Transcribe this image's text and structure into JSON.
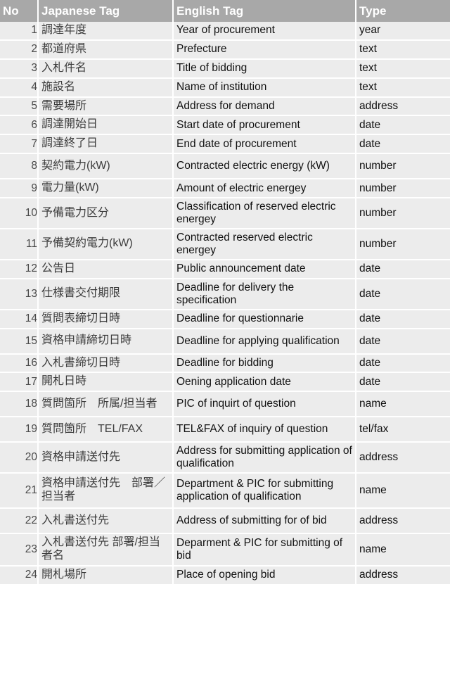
{
  "table": {
    "columns": [
      {
        "key": "no",
        "label": "No"
      },
      {
        "key": "ja",
        "label": "Japanese Tag"
      },
      {
        "key": "en",
        "label": "English Tag"
      },
      {
        "key": "type",
        "label": "Type"
      }
    ],
    "colors": {
      "header_background": "#a8a8a8",
      "header_text": "#ffffff",
      "row_background": "#ececec",
      "row_separator": "#ffffff",
      "body_text": "#111111",
      "japanese_text": "#3c3c3c",
      "page_background": "#ffffff"
    },
    "rows": [
      {
        "no": "1",
        "ja": "調達年度",
        "en": "Year of procurement",
        "type": "year",
        "lines": 1
      },
      {
        "no": "2",
        "ja": "都道府県",
        "en": "Prefecture",
        "type": "text",
        "lines": 1
      },
      {
        "no": "3",
        "ja": "入札件名",
        "en": "Title of bidding",
        "type": "text",
        "lines": 1
      },
      {
        "no": "4",
        "ja": "施設名",
        "en": "Name of institution",
        "type": "text",
        "lines": 1
      },
      {
        "no": "5",
        "ja": "需要場所",
        "en": "Address for demand",
        "type": "address",
        "lines": 1
      },
      {
        "no": "6",
        "ja": "調達開始日",
        "en": "Start date of procurement",
        "type": "date",
        "lines": 1
      },
      {
        "no": "7",
        "ja": "調達終了日",
        "en": "End date of procurement",
        "type": "date",
        "lines": 1
      },
      {
        "no": "8",
        "ja": "契約電力(kW)",
        "en": "Contracted electric energy (kW)",
        "type": "number",
        "lines": 2
      },
      {
        "no": "9",
        "ja": "電力量(kW)",
        "en": "Amount of electric energey",
        "type": "number",
        "lines": 1
      },
      {
        "no": "10",
        "ja": "予備電力区分",
        "en": "Classification of reserved electric energey",
        "type": "number",
        "lines": 2
      },
      {
        "no": "11",
        "ja": "予備契約電力(kW)",
        "en": "Contracted reserved electric energey",
        "type": "number",
        "lines": 2
      },
      {
        "no": "12",
        "ja": "公告日",
        "en": "Public announcement date",
        "type": "date",
        "lines": 1
      },
      {
        "no": "13",
        "ja": "仕様書交付期限",
        "en": "Deadline for delivery the specification",
        "type": "date",
        "lines": 2
      },
      {
        "no": "14",
        "ja": "質問表締切日時",
        "en": "Deadline for questionnarie",
        "type": "date",
        "lines": 1
      },
      {
        "no": "15",
        "ja": "資格申請締切日時",
        "en": "Deadline for applying qualification",
        "type": "date",
        "lines": 2
      },
      {
        "no": "16",
        "ja": "入札書締切日時",
        "en": "Deadline for bidding",
        "type": "date",
        "lines": 1
      },
      {
        "no": "17",
        "ja": "開札日時",
        "en": "Oening application date",
        "type": "date",
        "lines": 1
      },
      {
        "no": "18",
        "ja": "質問箇所　所属/担当者",
        "en": "PIC of inquirt of question",
        "type": "name",
        "lines": 2
      },
      {
        "no": "19",
        "ja": "質問箇所　TEL/FAX",
        "en": "TEL&FAX of inquiry of question",
        "type": "tel/fax",
        "lines": 2
      },
      {
        "no": "20",
        "ja": "資格申請送付先",
        "en": "Address for submitting application of qualification",
        "type": "address",
        "lines": 2
      },
      {
        "no": "21",
        "ja": "資格申請送付先　部署／担当者",
        "en": "Department & PIC  for submitting application of qualification",
        "type": "name",
        "lines": 3
      },
      {
        "no": "22",
        "ja": "入札書送付先",
        "en": "Address of submitting for of bid",
        "type": "address",
        "lines": 2
      },
      {
        "no": "23",
        "ja": "入札書送付先 部署/担当者名",
        "en": "Deparment & PIC for submitting of bid",
        "type": "name",
        "lines": 2
      },
      {
        "no": "24",
        "ja": "開札場所",
        "en": "Place of opening bid",
        "type": "address",
        "lines": 1
      }
    ]
  }
}
